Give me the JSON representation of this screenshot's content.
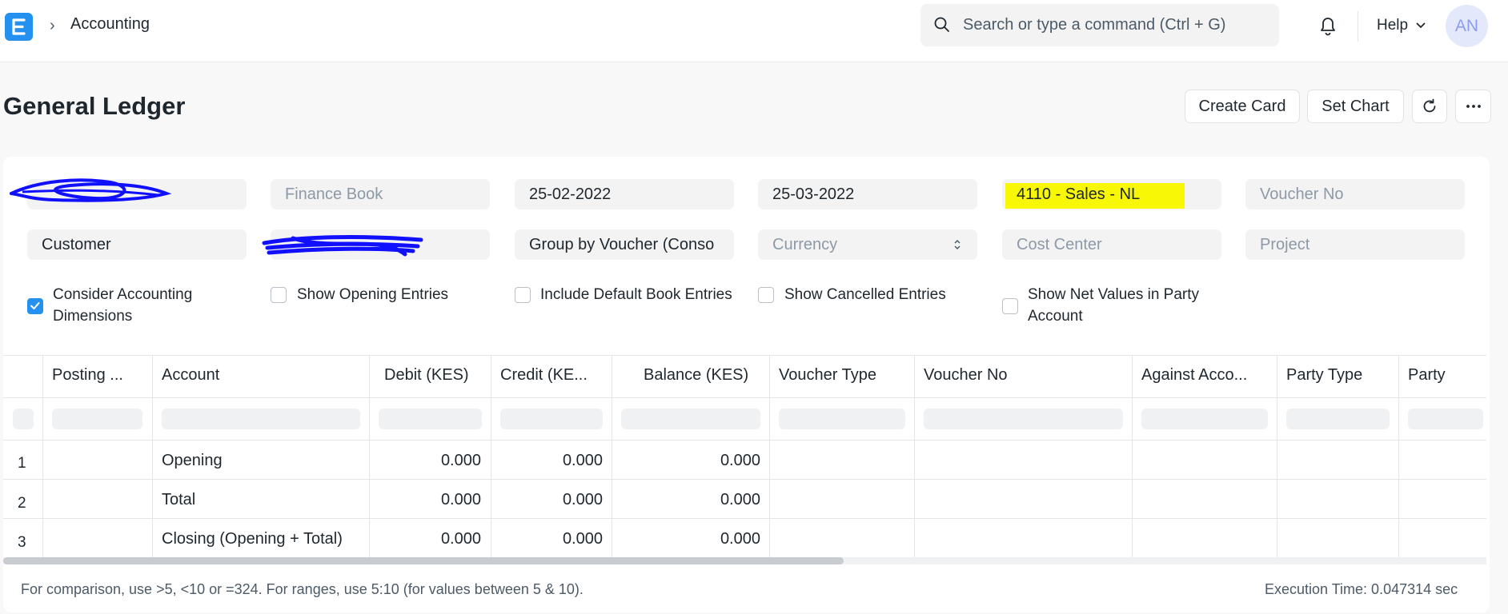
{
  "navbar": {
    "breadcrumb": "Accounting",
    "search_placeholder": "Search or type a command (Ctrl + G)",
    "help_label": "Help",
    "avatar_initials": "AN"
  },
  "page": {
    "title": "General Ledger",
    "buttons": {
      "create_card": "Create Card",
      "set_chart": "Set Chart"
    }
  },
  "filters": {
    "finance_book_placeholder": "Finance Book",
    "from_date": "25-02-2022",
    "to_date": "25-03-2022",
    "account": "4110 - Sales - NL",
    "voucher_no_placeholder": "Voucher No",
    "party_type": "Customer",
    "group_by": "Group by Voucher (Conso",
    "currency_placeholder": "Currency",
    "cost_center_placeholder": "Cost Center",
    "project_placeholder": "Project"
  },
  "checkboxes": [
    {
      "label_line1": "Consider Accounting",
      "label_line2": "Dimensions",
      "checked": true
    },
    {
      "label": "Show Opening Entries",
      "checked": false
    },
    {
      "label": "Include Default Book Entries",
      "checked": false
    },
    {
      "label": "Show Cancelled Entries",
      "checked": false
    },
    {
      "label_line1": "Show Net Values in Party",
      "label_line2": "Account",
      "checked": false
    }
  ],
  "table": {
    "columns": [
      "Posting ...",
      "Account",
      "Debit (KES)",
      "Credit (KE...",
      "Balance (KES)",
      "Voucher Type",
      "Voucher No",
      "Against Acco...",
      "Party Type",
      "Party"
    ],
    "rows": [
      {
        "n": "1",
        "account": "Opening",
        "debit": "0.000",
        "credit": "0.000",
        "balance": "0.000"
      },
      {
        "n": "2",
        "account": "Total",
        "debit": "0.000",
        "credit": "0.000",
        "balance": "0.000"
      },
      {
        "n": "3",
        "account": "Closing (Opening + Total)",
        "debit": "0.000",
        "credit": "0.000",
        "balance": "0.000"
      }
    ]
  },
  "footer": {
    "hint": "For comparison, use >5, <10 or =324. For ranges, use 5:10 (for values between 5 & 10).",
    "execution_time": "Execution Time: 0.047314 sec"
  },
  "colors": {
    "accent": "#2490ef",
    "highlight": "#f7f706",
    "redaction": "#0000ff"
  }
}
